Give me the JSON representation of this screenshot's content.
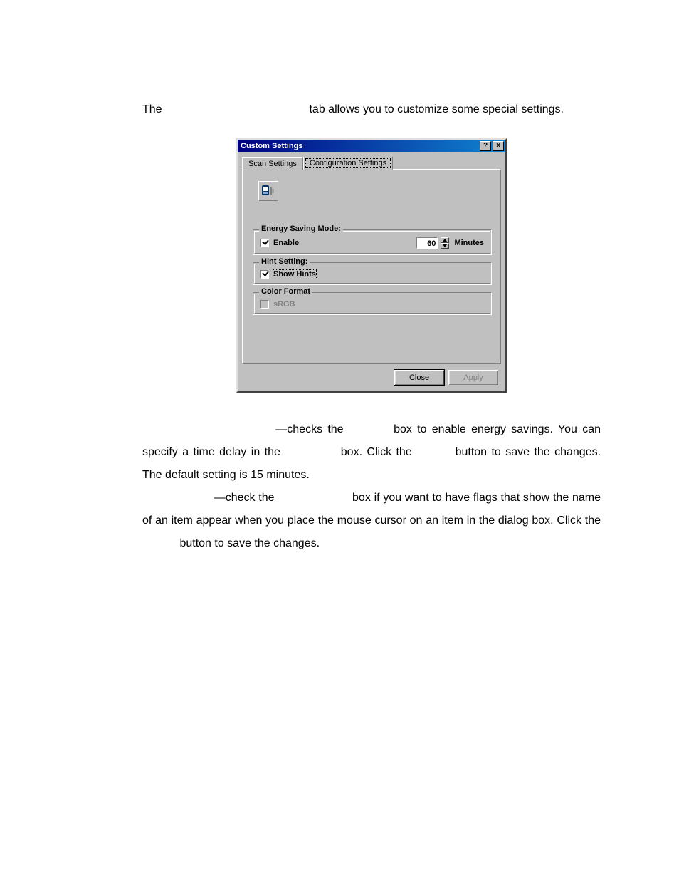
{
  "body": {
    "intro_the": "The",
    "intro_rest": "tab allows you to customize some special settings.",
    "p1_a": "—checks the",
    "p1_b": "box to enable energy savings. You",
    "p1_c": "can specify a time delay in the",
    "p1_d": "box.    Click the",
    "p1_e": "button to save",
    "p1_f": "the changes.    The default setting is 15 minutes.",
    "p2_a": "—check the",
    "p2_b": "box if you want to have flags that show",
    "p2_c": "the name of an item appear when you place the mouse cursor on an item in the",
    "p2_d": "dialog box.    Click the",
    "p2_e": "button to save the changes."
  },
  "dialog": {
    "title": "Custom Settings",
    "tabs": {
      "scan": {
        "label": "Scan Settings",
        "active": false
      },
      "config": {
        "label": "Configuration Settings",
        "active": true
      }
    },
    "energy": {
      "legend": "Energy Saving Mode:",
      "enable_label": "Enable",
      "enable_checked": true,
      "minutes_value": "60",
      "minutes_unit": "Minutes"
    },
    "hint": {
      "legend": "Hint Setting:",
      "show_hints_label": "Show Hints",
      "show_hints_checked": true
    },
    "color": {
      "legend": "Color Format",
      "srgb_label": "sRGB",
      "srgb_checked": false,
      "srgb_enabled": false
    },
    "buttons": {
      "close": "Close",
      "apply": "Apply",
      "apply_enabled": false
    },
    "title_buttons": {
      "help": "?",
      "close": "×"
    }
  }
}
